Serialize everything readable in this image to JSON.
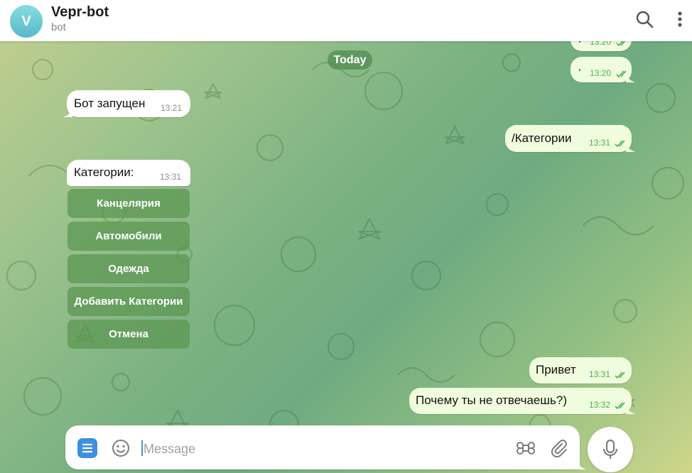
{
  "header": {
    "avatar_letter": "V",
    "title": "Vepr-bot",
    "subtitle": "bot",
    "search_icon": "search-icon",
    "menu_icon": "more-vertical-icon"
  },
  "date_separator": "Today",
  "messages": {
    "out_partial_1": {
      "text": "·",
      "time": "13:20"
    },
    "out_partial_2": {
      "text": "·",
      "time": "13:20"
    },
    "in_started": {
      "text": "Бот запущен",
      "time": "13:21"
    },
    "out_categories_cmd": {
      "text": "/Категории",
      "time": "13:31"
    },
    "in_categories": {
      "text": "Категории:",
      "time": "13:31"
    },
    "out_hello": {
      "text": "Привет",
      "time": "13:31"
    },
    "out_why": {
      "text": "Почему ты не отвечаешь?)",
      "time": "13:32"
    }
  },
  "inline_keyboard": [
    "Канцелярия",
    "Автомобили",
    "Одежда",
    "Добавить Категории",
    "Отмена"
  ],
  "composer": {
    "placeholder": "Message",
    "value": ""
  },
  "colors": {
    "outgoing_bubble": "#effdde",
    "incoming_bubble": "#ffffff",
    "read_checks": "#4fae4e",
    "accent_blue": "#3d8fe0"
  }
}
